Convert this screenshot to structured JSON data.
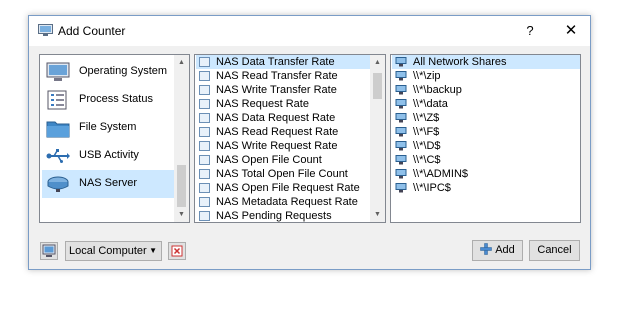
{
  "window": {
    "title": "Add Counter",
    "help_label": "?",
    "close_label": "✕"
  },
  "categories": [
    {
      "label": "Operating System",
      "icon": "monitor-icon",
      "selected": false
    },
    {
      "label": "Process Status",
      "icon": "process-list-icon",
      "selected": false
    },
    {
      "label": "File System",
      "icon": "folder-icon",
      "selected": false
    },
    {
      "label": "USB Activity",
      "icon": "usb-icon",
      "selected": false
    },
    {
      "label": "NAS Server",
      "icon": "nas-server-icon",
      "selected": true
    }
  ],
  "counters": [
    {
      "label": "NAS Data Transfer Rate",
      "selected": true
    },
    {
      "label": "NAS Read Transfer Rate",
      "selected": false
    },
    {
      "label": "NAS Write Transfer Rate",
      "selected": false
    },
    {
      "label": "NAS Request Rate",
      "selected": false
    },
    {
      "label": "NAS Data Request Rate",
      "selected": false
    },
    {
      "label": "NAS Read Request Rate",
      "selected": false
    },
    {
      "label": "NAS Write Request Rate",
      "selected": false
    },
    {
      "label": "NAS Open File Count",
      "selected": false
    },
    {
      "label": "NAS Total Open File Count",
      "selected": false
    },
    {
      "label": "NAS Open File Request Rate",
      "selected": false
    },
    {
      "label": "NAS Metadata Request Rate",
      "selected": false
    },
    {
      "label": "NAS Pending Requests",
      "selected": false
    }
  ],
  "instances": [
    {
      "label": "All Network Shares",
      "selected": true
    },
    {
      "label": "\\\\*\\zip",
      "selected": false
    },
    {
      "label": "\\\\*\\backup",
      "selected": false
    },
    {
      "label": "\\\\*\\data",
      "selected": false
    },
    {
      "label": "\\\\*\\Z$",
      "selected": false
    },
    {
      "label": "\\\\*\\F$",
      "selected": false
    },
    {
      "label": "\\\\*\\D$",
      "selected": false
    },
    {
      "label": "\\\\*\\C$",
      "selected": false
    },
    {
      "label": "\\\\*\\ADMIN$",
      "selected": false
    },
    {
      "label": "\\\\*\\IPC$",
      "selected": false
    }
  ],
  "footer": {
    "computer_select_value": "Local Computer",
    "add_label": "Add",
    "cancel_label": "Cancel"
  },
  "colors": {
    "selection": "#cde8ff",
    "dialog_bg": "#f0f0f0",
    "border_accent": "#7a9cc6"
  }
}
